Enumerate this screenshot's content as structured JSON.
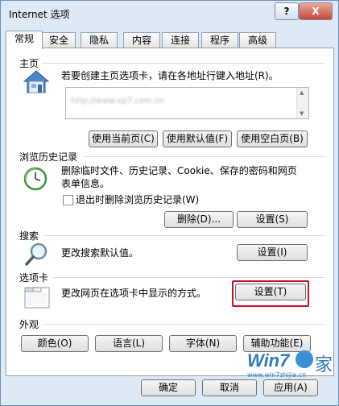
{
  "window": {
    "title": "Internet 选项",
    "help": "?",
    "close": "X"
  },
  "tabs": [
    "常规",
    "安全",
    "隐私",
    "内容",
    "连接",
    "程序",
    "高级"
  ],
  "homepage": {
    "title": "主页",
    "desc": "若要创建主页选项卡，请在各地址行键入地址(R)。",
    "url": "http://www.xp7.com.cn",
    "btn_current": "使用当前页(C)",
    "btn_default": "使用默认值(F)",
    "btn_blank": "使用空白页(B)"
  },
  "history": {
    "title": "浏览历史记录",
    "desc_line1": "删除临时文件、历史记录、Cookie、保存的密码和网页",
    "desc_line2": "表单信息。",
    "checkbox": "退出时删除浏览历史记录(W)",
    "btn_delete": "删除(D)...",
    "btn_settings": "设置(S)"
  },
  "search": {
    "title": "搜索",
    "desc": "更改搜索默认值。",
    "btn_settings": "设置(I)"
  },
  "tabs_section": {
    "title": "选项卡",
    "desc": "更改网页在选项卡中显示的方式。",
    "btn_settings": "设置(T)"
  },
  "appearance": {
    "title": "外观",
    "btn_colors": "颜色(O)",
    "btn_languages": "语言(L)",
    "btn_fonts": "字体(N)",
    "btn_accessibility": "辅助功能(E)"
  },
  "footer": {
    "ok": "确定",
    "cancel": "取消",
    "apply": "应用(A)"
  },
  "watermark": {
    "brand": "Win7",
    "cn": "家",
    "url": "www.win7zhijia.cn"
  },
  "colors": {
    "highlight": "#c8102e"
  }
}
